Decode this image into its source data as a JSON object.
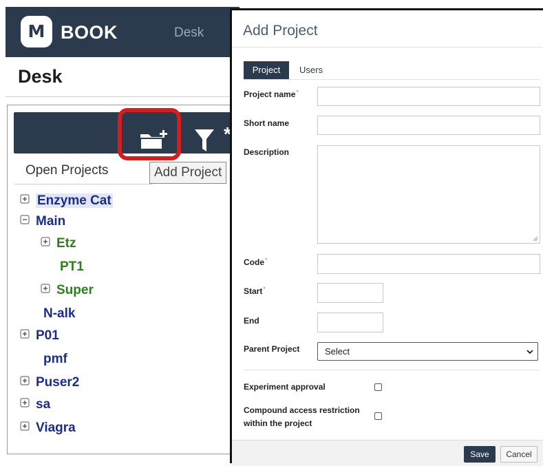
{
  "app": {
    "logo_letter": "M",
    "brand": "BOOK",
    "nav_desk": "Desk",
    "page_title": "Desk"
  },
  "panel": {
    "tab_label": "Open Projects",
    "tooltip": "Add Project",
    "tree": [
      {
        "label": "Enzyme Cat",
        "toggle": "plus",
        "color": "#1a2d8c",
        "selected": true
      },
      {
        "label": "Main",
        "toggle": "minus",
        "color": "#1a2d8c"
      },
      {
        "label": "Etz",
        "toggle": "plus",
        "color": "#2f7d20"
      },
      {
        "label": "PT1",
        "toggle": "none",
        "color": "#2f7d20"
      },
      {
        "label": "Super",
        "toggle": "plus",
        "color": "#2f7d20"
      },
      {
        "label": "N-alk",
        "toggle": "none",
        "color": "#1a2d8c"
      },
      {
        "label": "P01",
        "toggle": "plus",
        "color": "#1a2d8c"
      },
      {
        "label": "pmf",
        "toggle": "none",
        "color": "#1a2d8c"
      },
      {
        "label": "Puser2",
        "toggle": "plus",
        "color": "#1a2d8c"
      },
      {
        "label": "sa",
        "toggle": "plus",
        "color": "#1a2d8c"
      },
      {
        "label": "Viagra",
        "toggle": "plus",
        "color": "#1a2d8c"
      }
    ]
  },
  "modal": {
    "title": "Add Project",
    "tabs": [
      "Project",
      "Users"
    ],
    "fields": {
      "project_name": {
        "label": "Project name",
        "value": ""
      },
      "short_name": {
        "label": "Short name",
        "value": ""
      },
      "description": {
        "label": "Description",
        "value": ""
      },
      "code": {
        "label": "Code",
        "value": ""
      },
      "start": {
        "label": "Start",
        "value": ""
      },
      "end": {
        "label": "End",
        "value": ""
      },
      "parent_project": {
        "label": "Parent Project",
        "selected": "Select"
      }
    },
    "required_mark": "*",
    "checkboxes": {
      "experiment_approval": {
        "label": "Experiment approval",
        "checked": false
      },
      "compound_access": {
        "label": "Compound access restriction within the project",
        "checked": false
      }
    },
    "buttons": {
      "save": "Save",
      "cancel": "Cancel"
    }
  },
  "colors": {
    "navy": "#2b3a4d",
    "highlight_red": "#d41e1e",
    "tree_blue": "#1a2d8c",
    "tree_green": "#2f7d20"
  }
}
